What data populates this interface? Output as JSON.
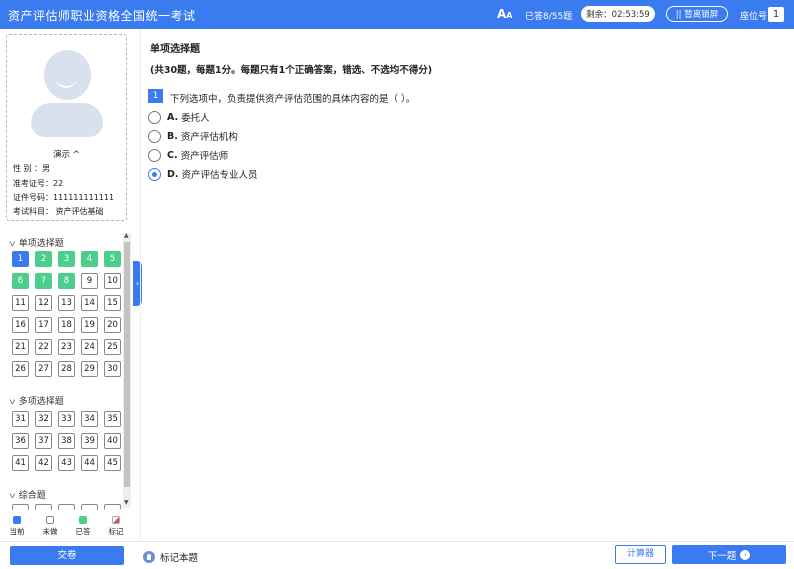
{
  "header": {
    "title": "资产评估师职业资格全国统一考试",
    "font_icon": "font-size-icon",
    "answered": "已答8/55题",
    "timer": "剩余：02:53:59",
    "lock_button": "|| 暂离锁屏",
    "seat_label": "座位号",
    "seat_number": "1"
  },
  "profile": {
    "demo_label": "演示 ^",
    "gender": "性    别  ：男",
    "ticket": "准考证号：22",
    "id_number": "证件号码：111111111111",
    "subject": "考试科目：  资产评估基础"
  },
  "sections": [
    {
      "label": "单项选择题",
      "numbers": [
        "1",
        "2",
        "3",
        "4",
        "5",
        "6",
        "7",
        "8",
        "9",
        "10",
        "11",
        "12",
        "13",
        "14",
        "15",
        "16",
        "17",
        "18",
        "19",
        "20",
        "21",
        "22",
        "23",
        "24",
        "25",
        "26",
        "27",
        "28",
        "29",
        "30"
      ],
      "done": [
        2,
        3,
        4,
        5,
        6,
        7,
        8
      ],
      "current": 1
    },
    {
      "label": "多项选择题",
      "numbers": [
        "31",
        "32",
        "33",
        "34",
        "35",
        "36",
        "37",
        "38",
        "39",
        "40",
        "41",
        "42",
        "43",
        "44",
        "45"
      ]
    },
    {
      "label": "综合题"
    }
  ],
  "legend": {
    "current": "当前",
    "undone": "未做",
    "answered": "已答",
    "marked": "标记",
    "colors": {
      "current": "#3B7BF0",
      "done": "#4ccf8c",
      "marked": "#e24c4c"
    }
  },
  "main": {
    "section_title": "单项选择题",
    "section_desc": "(共30题，每题1分。每题只有1个正确答案，错选、不选均不得分)",
    "question_number": "1",
    "question_text": "下列选项中，负责提供资产评估范围的具体内容的是（    ）。",
    "options": [
      {
        "letter": "A.",
        "text": "委托人",
        "checked": false
      },
      {
        "letter": "B.",
        "text": "资产评估机构",
        "checked": false
      },
      {
        "letter": "C.",
        "text": "资产评估师",
        "checked": false
      },
      {
        "letter": "D.",
        "text": "资产评估专业人员",
        "checked": true
      }
    ]
  },
  "footer": {
    "submit": "交卷",
    "mark": "标记本题",
    "calculator": "计算器",
    "next": "下一题"
  }
}
